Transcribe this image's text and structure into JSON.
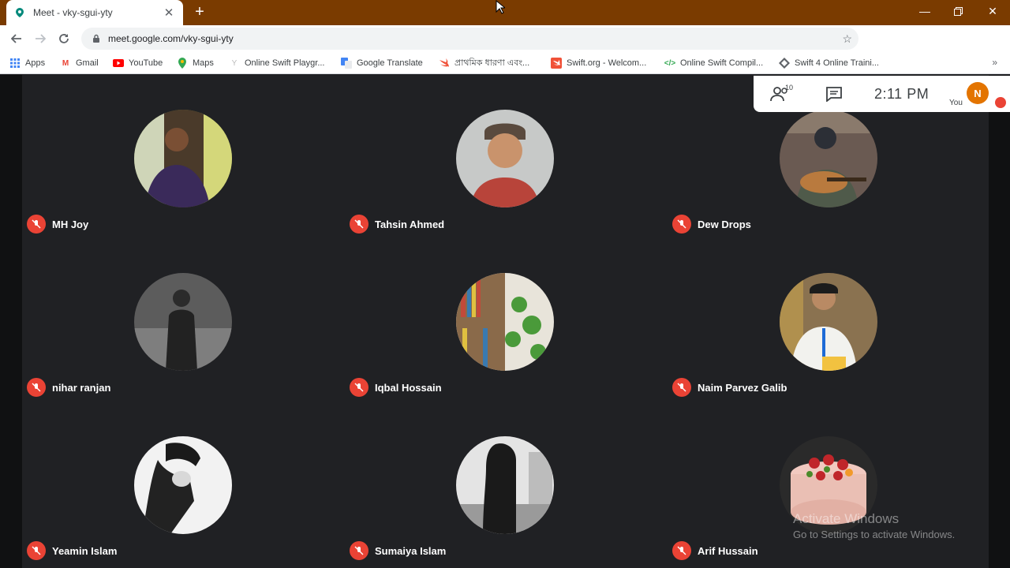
{
  "browser": {
    "tab_title": "Meet - vky-sgui-yty",
    "new_tab": "+",
    "url": "meet.google.com/vky-sgui-yty",
    "profile_initial": "N"
  },
  "bookmarks": [
    {
      "label": "Apps",
      "icon": "apps-grid-icon",
      "color": "#4285f4"
    },
    {
      "label": "Gmail",
      "icon": "gmail-icon",
      "color": "#ea4335"
    },
    {
      "label": "YouTube",
      "icon": "youtube-icon",
      "color": "#ff0000"
    },
    {
      "label": "Maps",
      "icon": "maps-pin-icon",
      "color": "#34a853"
    },
    {
      "label": "Online Swift Playgr...",
      "icon": "swift-icon",
      "color": "#f05138"
    },
    {
      "label": "Google Translate",
      "icon": "translate-icon",
      "color": "#4285f4"
    },
    {
      "label": "প্রাথমিক ধারণা এবং...",
      "icon": "swift-icon",
      "color": "#f05138"
    },
    {
      "label": "Swift.org - Welcom...",
      "icon": "swift-org-icon",
      "color": "#f05138"
    },
    {
      "label": "Online Swift Compil...",
      "icon": "code-icon",
      "color": "#34a853"
    },
    {
      "label": "Swift 4 Online Traini...",
      "icon": "training-icon",
      "color": "#5f6368"
    }
  ],
  "meeting": {
    "participant_count": "10",
    "time": "2:11 PM",
    "you_label": "You",
    "you_initial": "N"
  },
  "participants": [
    {
      "name": "MH Joy"
    },
    {
      "name": "Tahsin Ahmed"
    },
    {
      "name": "Dew Drops"
    },
    {
      "name": "nihar ranjan"
    },
    {
      "name": "Iqbal Hossain"
    },
    {
      "name": "Naim Parvez Galib"
    },
    {
      "name": "Yeamin Islam"
    },
    {
      "name": "Sumaiya Islam"
    },
    {
      "name": "Arif Hussain"
    }
  ],
  "watermark": {
    "line1": "Activate Windows",
    "line2": "Go to Settings to activate Windows."
  },
  "colors": {
    "accent": "#e37400",
    "mic_off": "#ea4335",
    "titlebar": "#7a3b00",
    "tile_bg": "#202124"
  }
}
